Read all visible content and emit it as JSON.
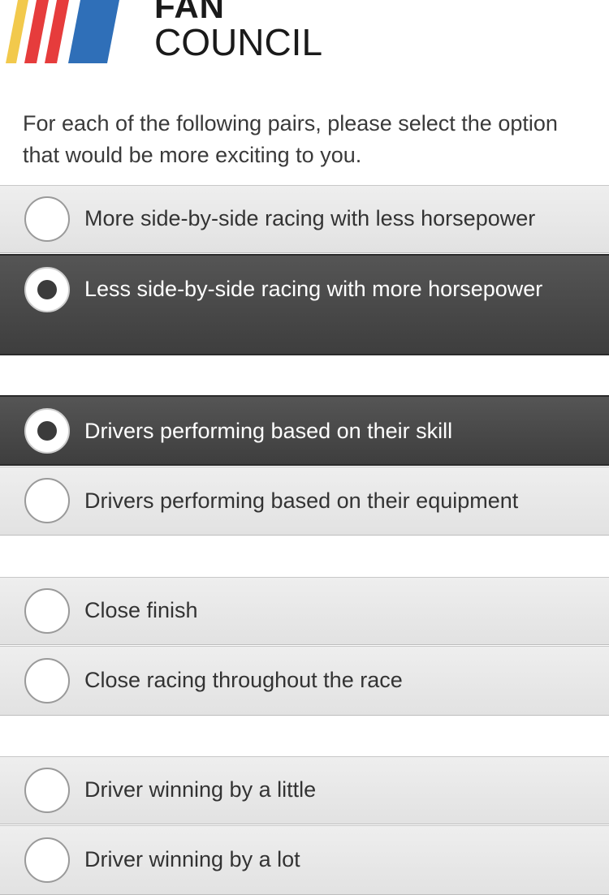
{
  "header": {
    "logo_line1": "FAN",
    "logo_line2": "COUNCIL",
    "stripe_colors": [
      "#f2c94c",
      "#e63c3c",
      "#e63c3c",
      "#2f6fb8"
    ]
  },
  "instructions": "For each of the following pairs, please select the option that would be more exciting to you.",
  "pairs": [
    {
      "options": [
        {
          "label": "More side-by-side racing with less horsepower",
          "selected": false
        },
        {
          "label": "Less side-by-side racing with more horsepower",
          "selected": true
        }
      ]
    },
    {
      "options": [
        {
          "label": "Drivers performing based on their skill",
          "selected": true
        },
        {
          "label": "Drivers performing based on their equipment",
          "selected": false
        }
      ]
    },
    {
      "options": [
        {
          "label": "Close finish",
          "selected": false
        },
        {
          "label": "Close racing throughout the race",
          "selected": false
        }
      ]
    },
    {
      "options": [
        {
          "label": "Driver winning by a little",
          "selected": false
        },
        {
          "label": "Driver winning by a lot",
          "selected": false
        }
      ]
    }
  ]
}
